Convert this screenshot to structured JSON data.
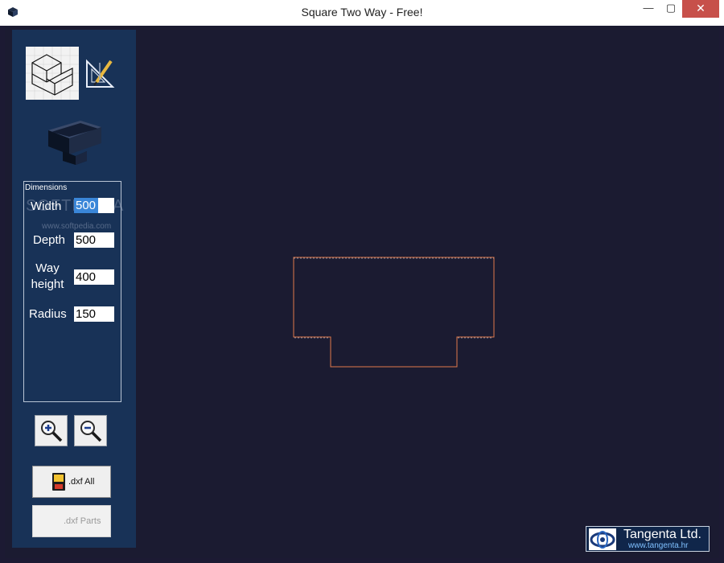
{
  "window": {
    "title": "Square Two Way  - Free!",
    "minimize_glyph": "—",
    "maximize_glyph": "▢",
    "close_glyph": "✕"
  },
  "dimensions": {
    "group_label": "Dimensions",
    "width_label": "Width",
    "width_value": "500",
    "depth_label": "Depth",
    "depth_value": "500",
    "way_height_label_line1": "Way",
    "way_height_label_line2": "height",
    "way_height_value": "400",
    "radius_label": "Radius",
    "radius_value": "150",
    "selected_text": "500"
  },
  "watermark": {
    "brand": "SOFTPEDIA",
    "url": "www.softpedia.com"
  },
  "buttons": {
    "dxf_all": ".dxf All",
    "dxf_parts": ".dxf Parts"
  },
  "icons": {
    "isometric_view": "isometric-cube-icon",
    "drawing_tools": "drawing-tools-icon",
    "part_preview": "3d-part-icon",
    "zoom_in": "zoom-in-icon",
    "zoom_out": "zoom-out-icon",
    "save": "floppy-disk-icon"
  },
  "logo": {
    "name": "Tangenta Ltd.",
    "url": "www.tangenta.hr"
  },
  "colors": {
    "canvas_bg": "#1b1b31",
    "panel_bg": "#183257",
    "outline": "#e07a4a",
    "selection": "#3a86d8"
  }
}
